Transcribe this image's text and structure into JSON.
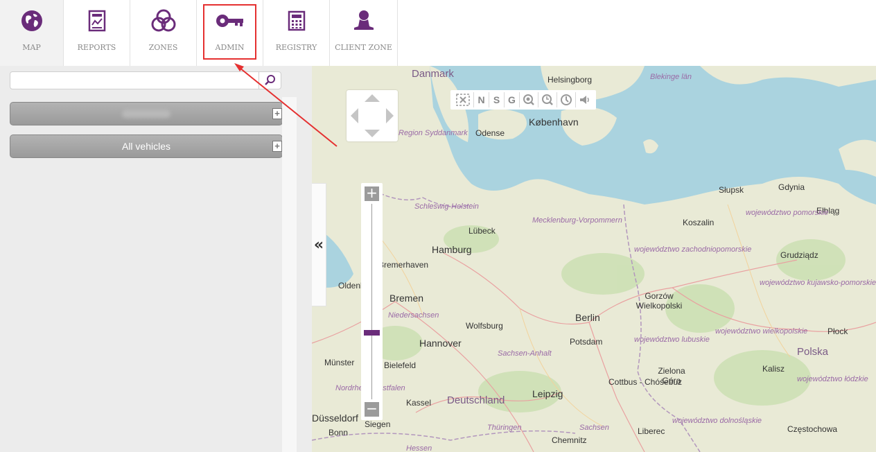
{
  "nav": {
    "items": [
      {
        "label": "MAP",
        "icon": "globe-icon"
      },
      {
        "label": "REPORTS",
        "icon": "report-icon"
      },
      {
        "label": "ZONES",
        "icon": "zones-icon"
      },
      {
        "label": "ADMIN",
        "icon": "key-icon"
      },
      {
        "label": "REGISTRY",
        "icon": "calculator-icon"
      },
      {
        "label": "CLIENT ZONE",
        "icon": "user-icon"
      }
    ],
    "accent": "#6a2c7a",
    "highlight_color": "#e53030"
  },
  "sidebar": {
    "search_value": "",
    "groups": [
      {
        "label": ""
      },
      {
        "label": "All vehicles"
      }
    ],
    "collapse_label": "«"
  },
  "map_toolbar": {
    "buttons": [
      "fit-icon",
      "N",
      "S",
      "G",
      "zoom-search-icon",
      "zoom-time-icon",
      "clock-icon",
      "sound-icon"
    ]
  },
  "zoom": {
    "plus": "+",
    "minus": "−"
  },
  "map_labels": {
    "countries": [
      "Danmark",
      "Deutschland"
    ],
    "cities": [
      "Helsingborg",
      "København",
      "Odense",
      "Lübeck",
      "Hamburg",
      "Bremerhaven",
      "Bremen",
      "Oldenburg",
      "Wolfsburg",
      "Berlin",
      "Potsdam",
      "Hannover",
      "Bielefeld",
      "Münster",
      "Leipzig",
      "Kassel",
      "Cottbus - Chóśebuz",
      "Düsseldorf",
      "Bonn",
      "Siegen",
      "Chemnitz",
      "Liberec",
      "Słupsk",
      "Gdynia",
      "Elbląg",
      "Koszalin",
      "Grudziądz",
      "Gorzów Wielkopolski",
      "Zielona Góra",
      "Kalisz",
      "Płock",
      "Polska",
      "Częstochowa"
    ],
    "regions": [
      "Blekinge län",
      "Region Syddanmark",
      "Schleswig-Holstein",
      "Mecklenburg-Vorpommern",
      "województwo zachodniopomorskie",
      "województwo pomorskie",
      "województwo kujawsko-pomorskie",
      "Niedersachsen",
      "Sachsen-Anhalt",
      "województwo lubuskie",
      "województwo wielkopolskie",
      "województwo łódzkie",
      "Nordrhein-Westfalen",
      "Thüringen",
      "Sachsen",
      "województwo dolnośląskie",
      "Hessen"
    ]
  }
}
